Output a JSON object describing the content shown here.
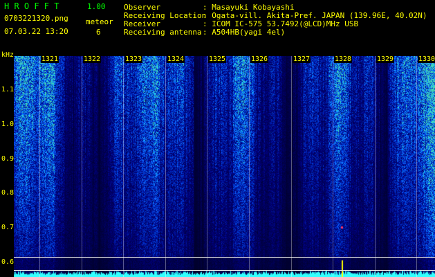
{
  "header": {
    "app_name": "H R O F F T",
    "version": "1.00",
    "filename": "0703221320.png",
    "datetime": "07.03.22 13:20",
    "meteor_label": "meteor",
    "meteor_count": "6"
  },
  "info": {
    "rows": [
      {
        "label": "Observer",
        "value": ": Masayuki Kobayashi"
      },
      {
        "label": "Receiving Location",
        "value": ": Ogata-vill. Akita-Pref. JAPAN (139.96E, 40.02N)"
      },
      {
        "label": "Receiver",
        "value": ": ICOM IC-575 53.7492(@LCD)MHz USB"
      },
      {
        "label": "Receiving antenna",
        "value": ": A504HB(yagi 4el)"
      }
    ]
  },
  "spectrogram": {
    "y_unit": "kHz",
    "y_ticks": [
      "1.1",
      "1.0",
      "0.9",
      "0.8",
      "0.7",
      "0.6"
    ],
    "time_labels": [
      "1321",
      "1322",
      "1323",
      "1324",
      "1325",
      "1326",
      "1327",
      "1328",
      "1329",
      "1330"
    ],
    "colors": {
      "background": "#000028",
      "low": "#0a1a8a",
      "mid": "#2a6cff",
      "high": "#66ffcc",
      "accent": "#ffff00"
    },
    "icons": {
      "meteor_mark": "meteor-ping-mark"
    }
  }
}
